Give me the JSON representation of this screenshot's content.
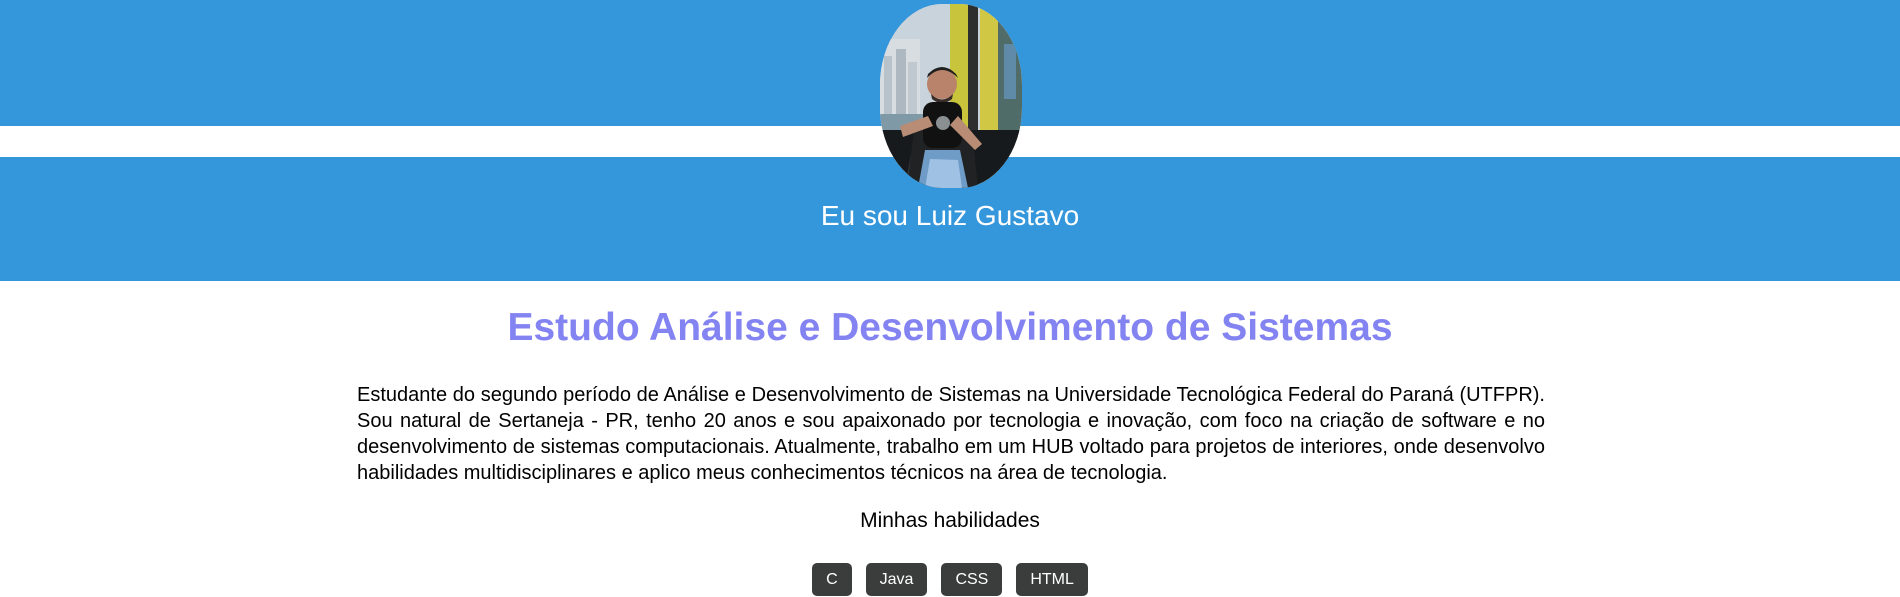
{
  "colors": {
    "header_band": "#3597db",
    "heading_text": "#8383f2",
    "skill_badge": "#3b3d3d"
  },
  "header": {
    "avatar_icon": "profile-photo",
    "title": "Eu sou Luiz Gustavo"
  },
  "main": {
    "heading": "Estudo Análise e Desenvolvimento de Sistemas",
    "bio": "Estudante do segundo período de Análise e Desenvolvimento de Sistemas na Universidade Tecnológica Federal do Paraná (UTFPR). Sou natural de Sertaneja - PR, tenho 20 anos e sou apaixonado por tecnologia e inovação, com foco na criação de software e no desenvolvimento de sistemas computacionais. Atualmente, trabalho em um HUB voltado para projetos de interiores, onde desenvolvo habilidades multidisciplinares e aplico meus conhecimentos técnicos na área de tecnologia.",
    "skills_title": "Minhas habilidades",
    "skills": [
      "C",
      "Java",
      "CSS",
      "HTML"
    ]
  }
}
